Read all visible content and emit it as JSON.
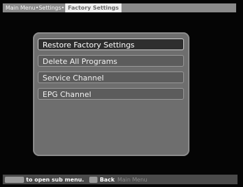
{
  "breadcrumb": {
    "items": [
      "Main Menu",
      "Settings"
    ],
    "separator": "•",
    "current": "Factory Settings"
  },
  "menu": {
    "items": [
      {
        "label": "Restore Factory Settings",
        "selected": true
      },
      {
        "label": "Delete All Programs",
        "selected": false
      },
      {
        "label": "Service Channel",
        "selected": false
      },
      {
        "label": "EPG Channel",
        "selected": false
      }
    ]
  },
  "footer": {
    "ok_hint": "to open sub menu.",
    "back_hint": "Back",
    "extra_hint": "Main Menu"
  },
  "colors": {
    "panel": "#6e6e6e",
    "selected_item": "#2e2e2e",
    "breadcrumb_bar": "#8a8a8a"
  }
}
